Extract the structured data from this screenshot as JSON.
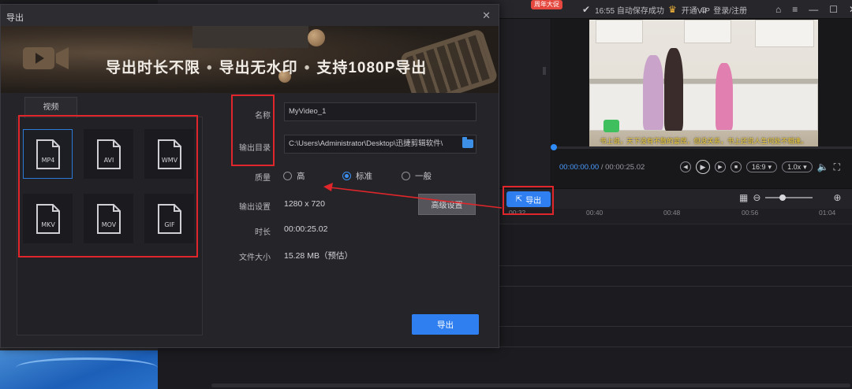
{
  "dialog": {
    "title": "导出",
    "banner_text": [
      "导出时长不限",
      "导出无水印",
      "支持1080P导出"
    ],
    "format_tab": "视频",
    "formats": [
      "MP4",
      "AVI",
      "WMV",
      "MKV",
      "MOV",
      "GIF"
    ],
    "selected_format": "MP4",
    "fields": {
      "name_label": "名称",
      "name_value": "MyVideo_1",
      "output_label": "输出目录",
      "output_value": "C:\\Users\\Administrator\\Desktop\\迅捷剪辑软件\\",
      "quality_label": "质量",
      "quality_options": [
        "高",
        "标准",
        "一般"
      ],
      "quality_selected": "标准",
      "settings_label": "输出设置",
      "settings_value": "1280 x 720",
      "advanced_button": "高级设置",
      "duration_label": "时长",
      "duration_value": "00:00:25.02",
      "size_label": "文件大小",
      "size_value": "15.28 MB（预估）"
    },
    "export_button": "导出"
  },
  "app": {
    "status_time": "16:55 自动保存成功",
    "vip_label": "开通VIP",
    "vip_badge": "周年大促",
    "login_label": "登录/注册",
    "preview": {
      "subtitle": "书上说，天下没有不散的宴席，但没关系，书上还说人生何处不相逢。",
      "current_time": "00:00:00.00",
      "total_time": "/ 00:00:25.02",
      "aspect": "16:9",
      "speed": "1.0x"
    },
    "export_button": "导出",
    "ruler_ticks": [
      "00:32",
      "00:40",
      "00:48",
      "00:56",
      "01:04"
    ],
    "colors": {
      "accent": "#2f7ff0",
      "highlight": "#e0262a"
    }
  }
}
